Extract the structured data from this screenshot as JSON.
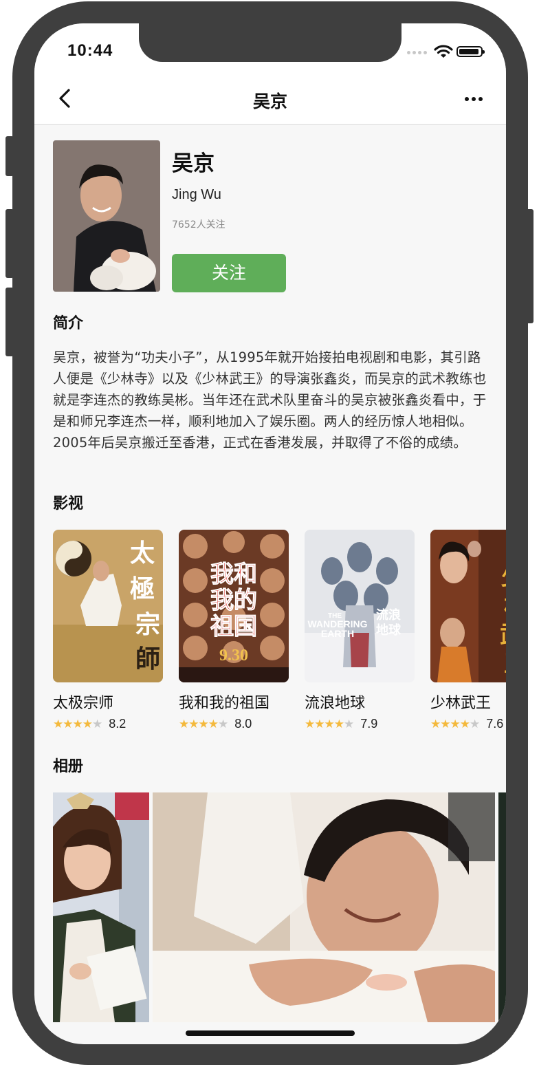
{
  "status_bar": {
    "time": "10:44"
  },
  "navbar": {
    "title": "吴京"
  },
  "profile": {
    "name": "吴京",
    "english_name": "Jing Wu",
    "followers": "7652人关注",
    "follow_button": "关注"
  },
  "sections": {
    "intro": "简介",
    "filmography": "影视",
    "album": "相册"
  },
  "intro_text": "吴京，被誉为“功夫小子”，从1995年就开始接拍电视剧和电影，其引路人便是《少林寺》以及《少林武王》的导演张鑫炎，而吴京的武术教练也就是李连杰的教练吴彬。当年还在武术队里奋斗的吴京被张鑫炎看中，于是和师兄李连杰一样，顺利地加入了娱乐圈。两人的经历惊人地相似。2005年后吴京搬迁至香港，正式在香港发展，并取得了不俗的成绩。",
  "movies": [
    {
      "title": "太极宗师",
      "score": "8.2",
      "stars": 4,
      "poster_text": "太极宗師"
    },
    {
      "title": "我和我的祖国",
      "score": "8.0",
      "stars": 4,
      "poster_text": "我和我的祖国",
      "poster_date": "9.30"
    },
    {
      "title": "流浪地球",
      "score": "7.9",
      "stars": 4,
      "poster_text": "THE WANDERING EARTH 流浪地球"
    },
    {
      "title": "少林武王",
      "score": "7.6",
      "stars": 4,
      "poster_text": "少林武王"
    }
  ],
  "colors": {
    "accent": "#5fae59",
    "star": "#f4b93c",
    "star_off": "#c8c8c8"
  }
}
